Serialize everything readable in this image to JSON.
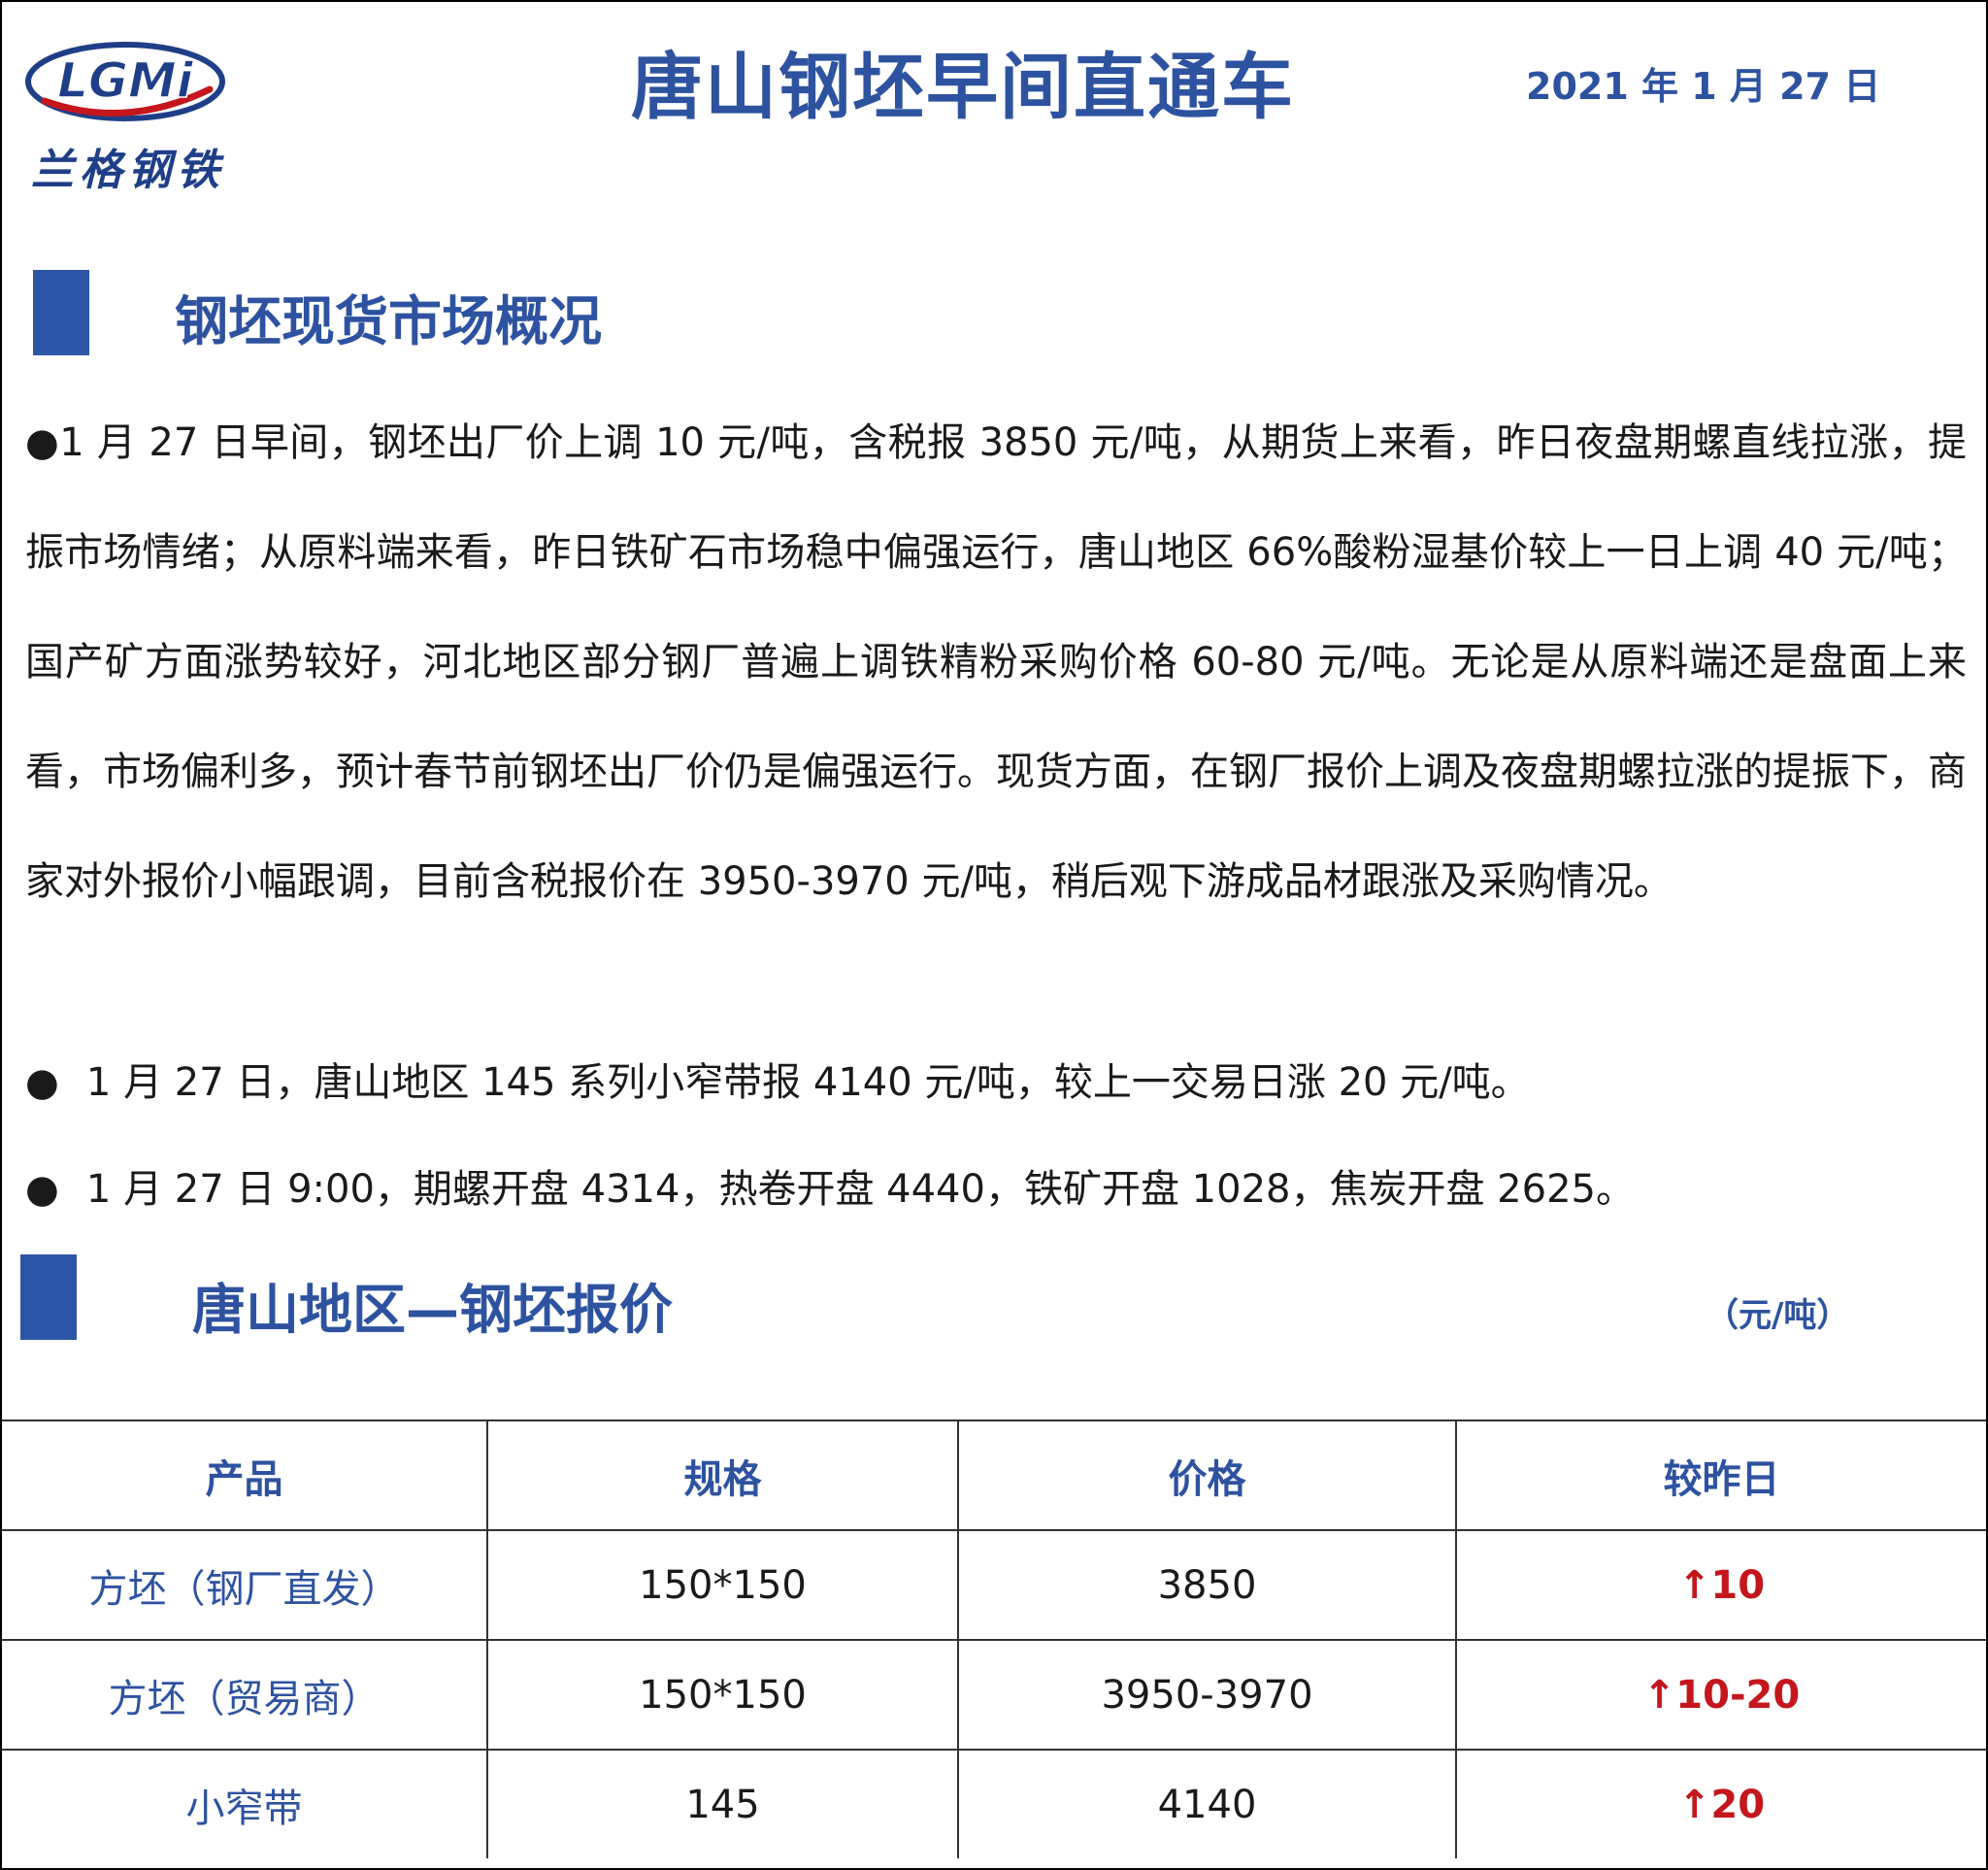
{
  "header": {
    "logo_mark": "LGMi",
    "logo_name": "兰格钢铁",
    "title": "唐山钢坯早间直通车",
    "date": "2021 年 1 月 27 日"
  },
  "section1": {
    "title": "钢坯现货市场概况",
    "paragraph": "●1 月 27 日早间，钢坯出厂价上调 10 元/吨，含税报 3850 元/吨，从期货上来看，昨日夜盘期螺直线拉涨，提振市场情绪；从原料端来看，昨日铁矿石市场稳中偏强运行，唐山地区 66%酸粉湿基价较上一日上调 40 元/吨；国产矿方面涨势较好，河北地区部分钢厂普遍上调铁精粉采购价格 60-80 元/吨。无论是从原料端还是盘面上来看，市场偏利多，预计春节前钢坯出厂价仍是偏强运行。现货方面，在钢厂报价上调及夜盘期螺拉涨的提振下，商家对外报价小幅跟调，目前含税报价在 3950-3970 元/吨，稍后观下游成品材跟涨及采购情况。",
    "bullets": [
      {
        "symbol": "●",
        "text": "1 月 27 日，唐山地区 145 系列小窄带报 4140 元/吨，较上一交易日涨 20 元/吨。"
      },
      {
        "symbol": "●",
        "text": "1 月 27 日 9:00，期螺开盘 4314，热卷开盘 4440，铁矿开盘 1028，焦炭开盘 2625。"
      }
    ]
  },
  "section2": {
    "title": "唐山地区—钢坯报价",
    "unit": "（元/吨）"
  },
  "table": {
    "headers": [
      "产品",
      "规格",
      "价格",
      "较昨日"
    ],
    "rows": [
      {
        "product": "方坯（钢厂直发）",
        "spec": "150*150",
        "price": "3850",
        "change": "↑10"
      },
      {
        "product": "方坯（贸易商）",
        "spec": "150*150",
        "price": "3950-3970",
        "change": "↑10-20"
      },
      {
        "product": "小窄带",
        "spec": "145",
        "price": "4140",
        "change": "↑20"
      }
    ]
  },
  "colors": {
    "brand_blue": "#2d52a0",
    "bar_blue": "#2e56a6",
    "up_red": "#c4161c"
  }
}
